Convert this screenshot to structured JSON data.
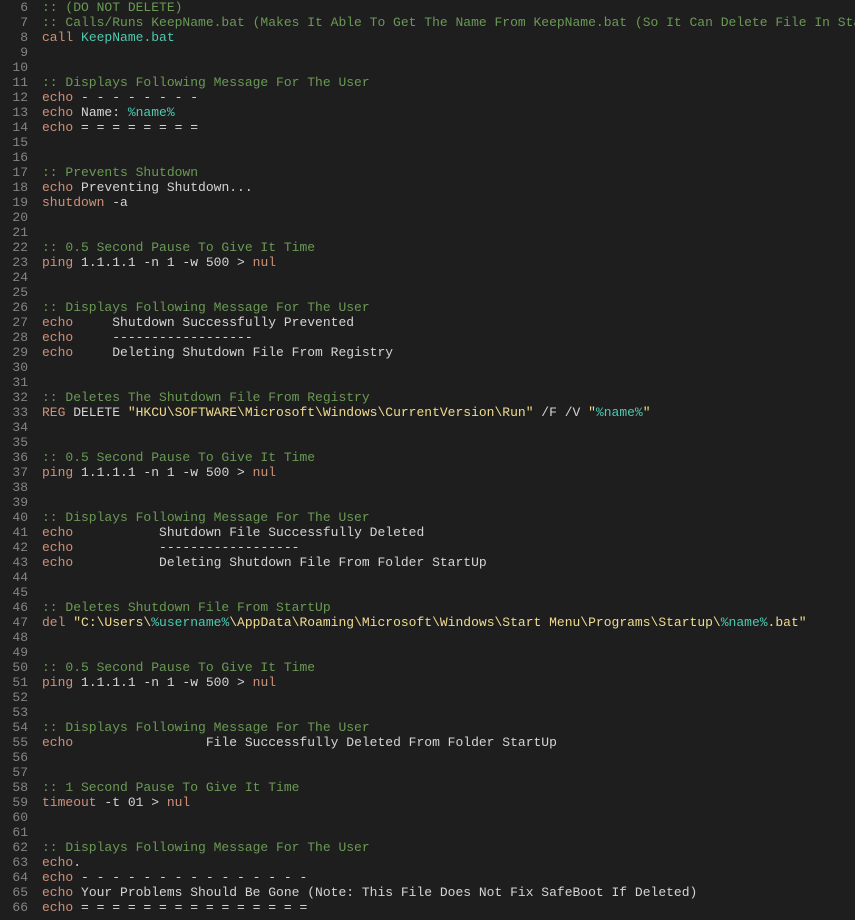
{
  "startLine": 6,
  "lines": [
    [
      [
        "comment",
        ":: (DO NOT DELETE)"
      ]
    ],
    [
      [
        "comment",
        ":: Calls/Runs KeepName.bat (Makes It Able To Get The Name From KeepName.bat (So It Can Delete File In StartUp))"
      ]
    ],
    [
      [
        "cmd",
        "call"
      ],
      [
        "plain",
        " "
      ],
      [
        "var",
        "KeepName.bat"
      ]
    ],
    [],
    [],
    [
      [
        "comment",
        ":: Displays Following Message For The User"
      ]
    ],
    [
      [
        "cmd",
        "echo"
      ],
      [
        "plain",
        " - - - - - - - -"
      ]
    ],
    [
      [
        "cmd",
        "echo"
      ],
      [
        "plain",
        " Name: "
      ],
      [
        "var",
        "%name%"
      ]
    ],
    [
      [
        "cmd",
        "echo"
      ],
      [
        "plain",
        " = = = = = = = ="
      ]
    ],
    [],
    [],
    [
      [
        "comment",
        ":: Prevents Shutdown"
      ]
    ],
    [
      [
        "cmd",
        "echo"
      ],
      [
        "plain",
        " Preventing Shutdown..."
      ]
    ],
    [
      [
        "cmd",
        "shutdown"
      ],
      [
        "plain",
        " -a"
      ]
    ],
    [],
    [],
    [
      [
        "comment",
        ":: 0.5 Second Pause To Give It Time"
      ]
    ],
    [
      [
        "cmd",
        "ping"
      ],
      [
        "plain",
        " 1.1.1.1 -n 1 -w 500 "
      ],
      [
        "op",
        "> "
      ],
      [
        "cmd",
        "nul"
      ]
    ],
    [],
    [],
    [
      [
        "comment",
        ":: Displays Following Message For The User"
      ]
    ],
    [
      [
        "cmd",
        "echo"
      ],
      [
        "plain",
        "     Shutdown Successfully Prevented"
      ]
    ],
    [
      [
        "cmd",
        "echo"
      ],
      [
        "plain",
        "     ------------------"
      ]
    ],
    [
      [
        "cmd",
        "echo"
      ],
      [
        "plain",
        "     Deleting Shutdown File From Registry"
      ]
    ],
    [],
    [],
    [
      [
        "comment",
        ":: Deletes The Shutdown File From Registry"
      ]
    ],
    [
      [
        "cmd",
        "REG"
      ],
      [
        "plain",
        " DELETE "
      ],
      [
        "string",
        "\"HKCU\\SOFTWARE\\Microsoft\\Windows\\CurrentVersion\\Run\""
      ],
      [
        "plain",
        " /F /V "
      ],
      [
        "string",
        "\""
      ],
      [
        "var",
        "%name%"
      ],
      [
        "string",
        "\""
      ]
    ],
    [],
    [],
    [
      [
        "comment",
        ":: 0.5 Second Pause To Give It Time"
      ]
    ],
    [
      [
        "cmd",
        "ping"
      ],
      [
        "plain",
        " 1.1.1.1 -n 1 -w 500 "
      ],
      [
        "op",
        "> "
      ],
      [
        "cmd",
        "nul"
      ]
    ],
    [],
    [],
    [
      [
        "comment",
        ":: Displays Following Message For The User"
      ]
    ],
    [
      [
        "cmd",
        "echo"
      ],
      [
        "plain",
        "           Shutdown File Successfully Deleted"
      ]
    ],
    [
      [
        "cmd",
        "echo"
      ],
      [
        "plain",
        "           ------------------"
      ]
    ],
    [
      [
        "cmd",
        "echo"
      ],
      [
        "plain",
        "           Deleting Shutdown File From Folder StartUp"
      ]
    ],
    [],
    [],
    [
      [
        "comment",
        ":: Deletes Shutdown File From StartUp"
      ]
    ],
    [
      [
        "cmd",
        "del"
      ],
      [
        "plain",
        " "
      ],
      [
        "string",
        "\"C:\\Users\\"
      ],
      [
        "var",
        "%username%"
      ],
      [
        "string",
        "\\AppData\\Roaming\\Microsoft\\Windows\\Start Menu\\Programs\\Startup\\"
      ],
      [
        "var",
        "%name%"
      ],
      [
        "string",
        ".bat\""
      ]
    ],
    [],
    [],
    [
      [
        "comment",
        ":: 0.5 Second Pause To Give It Time"
      ]
    ],
    [
      [
        "cmd",
        "ping"
      ],
      [
        "plain",
        " 1.1.1.1 -n 1 -w 500 "
      ],
      [
        "op",
        "> "
      ],
      [
        "cmd",
        "nul"
      ]
    ],
    [],
    [],
    [
      [
        "comment",
        ":: Displays Following Message For The User"
      ]
    ],
    [
      [
        "cmd",
        "echo"
      ],
      [
        "plain",
        "                 File Successfully Deleted From Folder StartUp"
      ]
    ],
    [],
    [],
    [
      [
        "comment",
        ":: 1 Second Pause To Give It Time"
      ]
    ],
    [
      [
        "cmd",
        "timeout"
      ],
      [
        "plain",
        " -t 01 "
      ],
      [
        "op",
        "> "
      ],
      [
        "cmd",
        "nul"
      ]
    ],
    [],
    [],
    [
      [
        "comment",
        ":: Displays Following Message For The User"
      ]
    ],
    [
      [
        "cmd",
        "echo"
      ],
      [
        "plain",
        "."
      ]
    ],
    [
      [
        "cmd",
        "echo"
      ],
      [
        "plain",
        " - - - - - - - - - - - - - - -"
      ]
    ],
    [
      [
        "cmd",
        "echo"
      ],
      [
        "plain",
        " Your Problems Should Be Gone (Note: This File Does Not Fix SafeBoot If Deleted)"
      ]
    ],
    [
      [
        "cmd",
        "echo"
      ],
      [
        "plain",
        " = = = = = = = = = = = = = = ="
      ]
    ]
  ]
}
